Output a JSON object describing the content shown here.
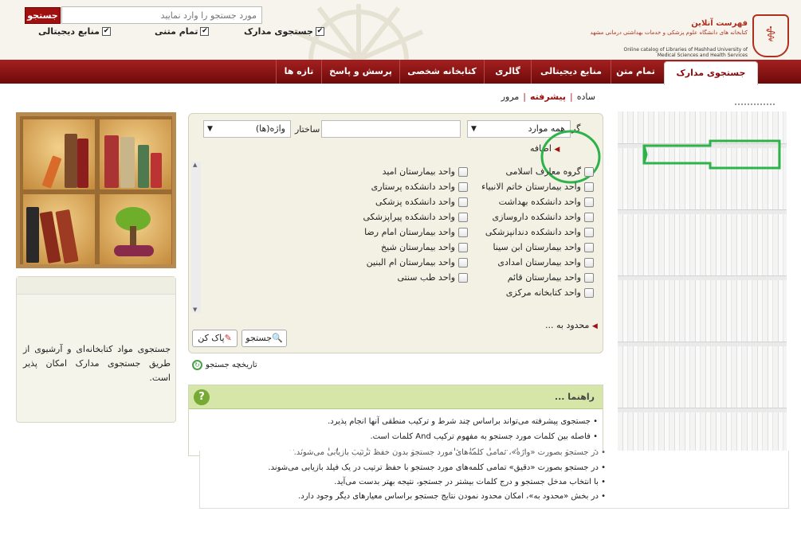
{
  "header": {
    "search_button": "جستجو",
    "search_placeholder": "مورد جستجو را وارد نمایید",
    "checkboxes": [
      {
        "label": "جستجوی مدارک",
        "checked": true
      },
      {
        "label": "تمام متنی",
        "checked": true
      },
      {
        "label": "منابع دیجیتالی",
        "checked": true
      }
    ],
    "logo": {
      "title": "فهرست آنلاین",
      "subtitle": "کتابخانه های دانشگاه علوم پزشکی و خدمات بهداشتی درمانی مشهد",
      "english": "Online catalog of Libraries of Mashhad University of Medical Sciences and Health Services"
    }
  },
  "nav": {
    "tabs": [
      {
        "label": "جستجوی مدارک",
        "active": true
      },
      {
        "label": "تمام متن"
      },
      {
        "label": "منابع دیجیتالی"
      },
      {
        "label": "گالری"
      },
      {
        "label": "کتابخانه شخصی"
      },
      {
        "label": "پرسش و پاسخ"
      },
      {
        "label": "تازه ها"
      }
    ]
  },
  "modes": {
    "simple": "ساده",
    "advanced": "پیشرفته",
    "browse": "مرور"
  },
  "side": {
    "text": "جستجوی مواد کتابخانه‌ای و آرشیوی از طریق جستجوی مدارک امکان پذیر است."
  },
  "form": {
    "all_items": "همه موارد",
    "structure_label": "ساختار",
    "words_select": "واژه(ها)",
    "add_link": "اضافه",
    "group_label": "گروه",
    "options_right": [
      "گروه معارف اسلامی",
      "واحد بیمارستان خاتم الانبیاء",
      "واحد دانشکده بهداشت",
      "واحد دانشکده داروسازی",
      "واحد دانشکده دندانپزشکی",
      "واحد بیمارستان ابن سینا",
      "واحد بیمارستان امدادی",
      "واحد بیمارستان قائم",
      "واحد کتابخانه مرکزی"
    ],
    "options_left": [
      "واحد بیمارستان امید",
      "واحد دانشکده پرستاری",
      "واحد دانشکده پزشکی",
      "واحد دانشکده پیراپزشکی",
      "واحد بیمارستان امام رضا",
      "واحد بیمارستان شیخ",
      "واحد بیمارستان ام البنین",
      "واحد طب سنتی"
    ],
    "limit_link": "محدود به ...",
    "search_button": "جستجو",
    "clear_button": "پاک کن"
  },
  "history": "تاریخچه جستجو",
  "help": {
    "title": "راهنما ...",
    "lines": [
      "جستجوی پیشرفته می‌تواند براساس چند شرط و ترکیب منطقی آنها انجام پذیرد.",
      "فاصله بین کلمات مورد جستجو به مفهوم ترکیب And کلمات است.",
      "در جستجو بصورت «واژه»، تمامی کلمه‌های مورد جستجو بدون حفظ ترتیب بازیابی می‌شوند.",
      "در جستجو بصورت «دقیق» تمامی کلمه‌های مورد جستجو با حفظ ترتیب در یک فیلد بازیابی می‌شوند.",
      "با انتخاب مدخل جستجو و درج کلمات بیشتر در جستجو، نتیجه بهتر بدست می‌آید.",
      "در بخش «محدود به»، امکان محدود نمودن نتایج جستجو براساس معیارهای دیگر وجود دارد."
    ]
  },
  "colors": {
    "brand_red": "#8a0a0a",
    "annotation_green": "#2db34a",
    "help_green": "#77a935"
  }
}
